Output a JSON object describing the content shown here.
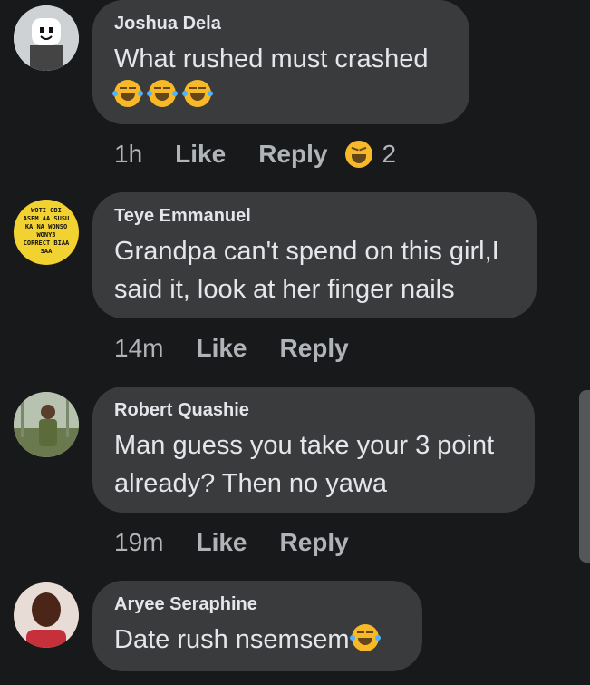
{
  "comments": [
    {
      "author": "Joshua Dela",
      "text": "What rushed must crashed",
      "emojis": [
        "rolling-laughing-emoji",
        "rolling-laughing-emoji",
        "rolling-laughing-emoji"
      ],
      "time": "1h",
      "like_label": "Like",
      "reply_label": "Reply",
      "reaction_icon": "laughing-reaction-icon",
      "reaction_count": "2"
    },
    {
      "author": "Teye Emmanuel",
      "avatar_text": [
        "WOTI OBI",
        "ASEM AA SUSU",
        "KA NA WONSO",
        "WONY3",
        "CORRECT BIAA",
        "SAA"
      ],
      "text_line1": "Grandpa can't spend on this girl,I",
      "text_line2": "said it, look at her finger nails",
      "time": "14m",
      "like_label": "Like",
      "reply_label": "Reply"
    },
    {
      "author": "Robert Quashie",
      "text_line1": "Man guess you take your 3 point",
      "text_line2": "already? Then no yawa",
      "time": "19m",
      "like_label": "Like",
      "reply_label": "Reply"
    },
    {
      "author": "Aryee Seraphine",
      "text": "Date rush nsemsem",
      "emoji": "rolling-laughing-emoji"
    }
  ],
  "colors": {
    "background": "#18191a",
    "bubble": "#3a3b3c",
    "text": "#e4e6eb",
    "secondary": "#b0b3b8",
    "emoji": "#f7b928"
  }
}
